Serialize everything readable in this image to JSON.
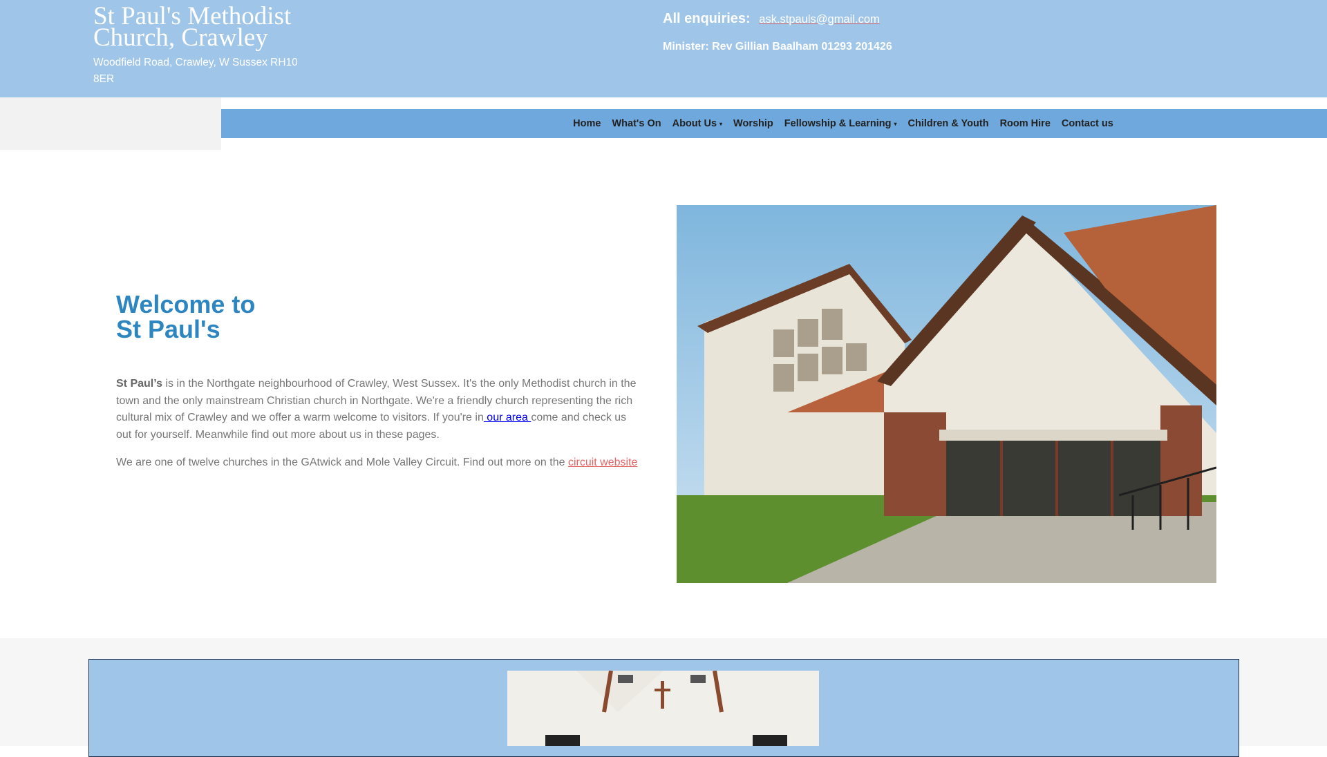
{
  "header": {
    "title": "St Paul's Methodist Church, Crawley",
    "address": "Woodfield Road, Crawley, W Sussex RH10 8ER",
    "enquiries_label": "All enquiries:",
    "email": "ask.stpauls@gmail.com",
    "minister": "Minister: Rev Gillian Baalham 01293 201426"
  },
  "nav": {
    "items": [
      {
        "label": "Home",
        "dropdown": false
      },
      {
        "label": "What's On",
        "dropdown": false
      },
      {
        "label": "About Us",
        "dropdown": true
      },
      {
        "label": "Worship",
        "dropdown": false
      },
      {
        "label": "Fellowship & Learning",
        "dropdown": true
      },
      {
        "label": "Children & Youth",
        "dropdown": false
      },
      {
        "label": "Room Hire",
        "dropdown": false
      },
      {
        "label": "Contact us",
        "dropdown": false
      }
    ],
    "caret": "▾"
  },
  "welcome": {
    "title_line1": "Welcome to",
    "title_line2": "St Paul's",
    "p1_bold": "St Paul’s",
    "p1_text": " is in the Northgate neighbourhood of Crawley, West Sussex. It's the only Methodist church in the town and the only mainstream Christian church in Northgate. We're a friendly church representing the rich cultural mix of Crawley and we offer a warm welcome to visitors. If you're in",
    "p1_link": " our area ",
    "p1_after": "come and check us out for yourself. Meanwhile find out more about us in these pages.",
    "p2_text": "We are one of twelve churches in the GAtwick and Mole Valley Circuit. Find out more on the ",
    "p2_link": "circuit website"
  },
  "colors": {
    "header_bg": "#9fc5e8",
    "nav_bg": "#6fa8dc",
    "title_blue": "#2e86c1",
    "link_red": "#e06666"
  }
}
